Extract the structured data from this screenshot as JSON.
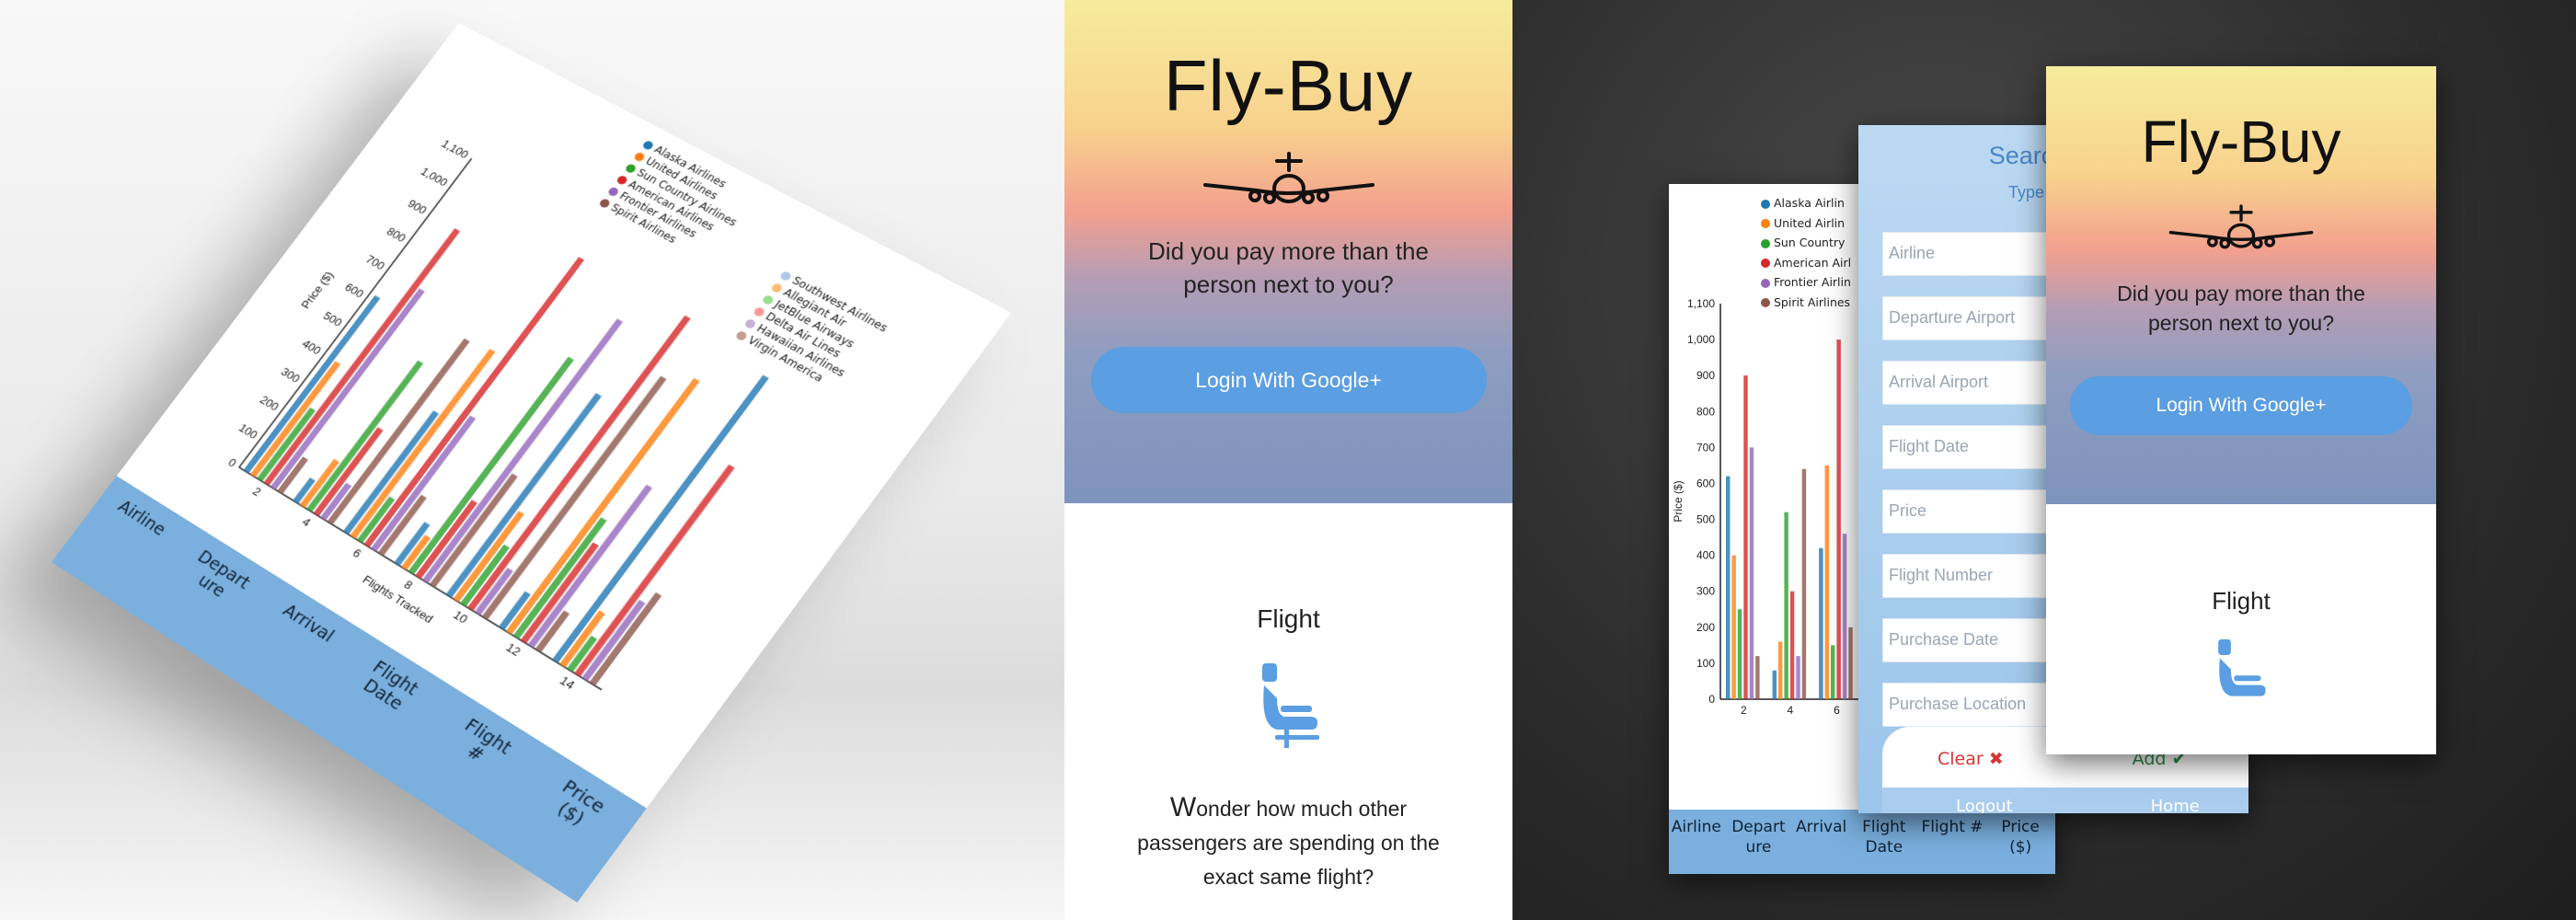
{
  "brand": {
    "title": "Fly-Buy",
    "tagline_line1": "Did you pay more than the",
    "tagline_line2": "person next to you?",
    "login_label": "Login With Google+"
  },
  "flight_section": {
    "heading": "Flight",
    "desc_initial": "W",
    "desc_line1": "onder how much other",
    "desc_line2": "passengers are spending on the",
    "desc_line3": "exact same flight?"
  },
  "chart_data": {
    "type": "bar",
    "ylabel": "Price ($)",
    "xlabel": "Flights Tracked",
    "y_ticks": [
      "0",
      "100",
      "200",
      "300",
      "400",
      "500",
      "600",
      "700",
      "800",
      "900",
      "1,000",
      "1,100"
    ],
    "x_ticks": [
      "2",
      "4",
      "6",
      "8",
      "10",
      "12",
      "14"
    ],
    "ylim": [
      0,
      1100
    ],
    "series": [
      {
        "name": "Alaska Airlines",
        "color": "#1f77b4",
        "values": [
          620,
          80,
          420,
          140,
          690,
          120,
          960
        ]
      },
      {
        "name": "United Airlines",
        "color": "#ff7f0e",
        "values": [
          400,
          160,
          650,
          110,
          300,
          860,
          180
        ]
      },
      {
        "name": "Sun Country Airlines",
        "color": "#2ca02c",
        "values": [
          250,
          520,
          150,
          740,
          200,
          400,
          110
        ]
      },
      {
        "name": "American Airlines",
        "color": "#d62728",
        "values": [
          900,
          300,
          1000,
          260,
          1000,
          330,
          700
        ]
      },
      {
        "name": "Frontier Airlines",
        "color": "#9467bd",
        "values": [
          700,
          120,
          460,
          900,
          150,
          540,
          260
        ]
      },
      {
        "name": "Spirit Airlines",
        "color": "#8c564b",
        "values": [
          120,
          640,
          200,
          380,
          820,
          130,
          300
        ]
      }
    ],
    "legend_right": [
      {
        "name": "Southwest Airlines",
        "color": "#aec7e8"
      },
      {
        "name": "Allegiant Air",
        "color": "#ffbb78"
      },
      {
        "name": "JetBlue Airways",
        "color": "#98df8a"
      },
      {
        "name": "Delta Air Lines",
        "color": "#ff9896"
      },
      {
        "name": "Hawaiian Airlines",
        "color": "#c5b0d5"
      },
      {
        "name": "Virgin America",
        "color": "#c49c94"
      }
    ]
  },
  "table_header": [
    "Airline",
    "Depart ure",
    "Arrival",
    "Flight Date",
    "Flight #",
    "Price ($)"
  ],
  "search": {
    "title": "Search f",
    "subtitle": "Type into an",
    "fields": [
      "Airline",
      "Departure Airport",
      "Arrival Airport",
      "Flight Date",
      "Price",
      "Flight Number",
      "Purchase Date",
      "Purchase Location"
    ],
    "clear_label": "Clear ✖",
    "add_label": "Add ✔",
    "logout_label": "Logout",
    "home_label": "Home"
  },
  "card_a_legend": [
    "Alaska Airlin",
    "United Airlin",
    "Sun Country",
    "American Airl",
    "Frontier Airlin",
    "Spirit Airlines"
  ],
  "colors": {
    "accent": "#5b9ee1",
    "table_bar": "#7aafde"
  }
}
